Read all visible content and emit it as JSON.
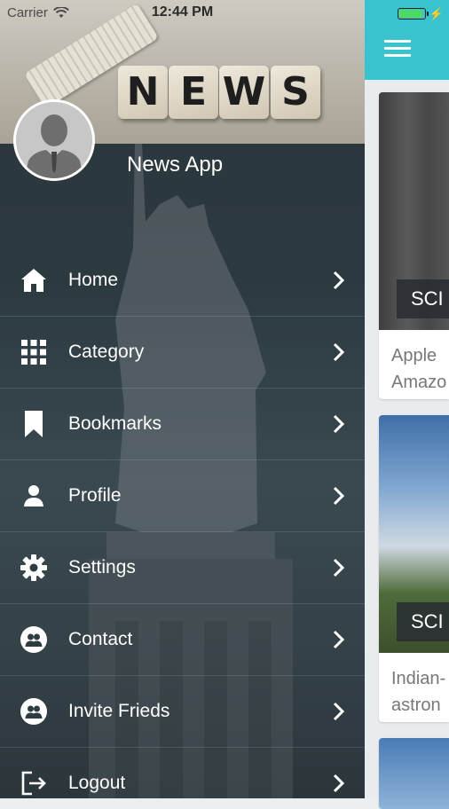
{
  "status_bar": {
    "carrier": "Carrier",
    "time": "12:44 PM",
    "battery_level": 1.0
  },
  "drawer": {
    "header_word": [
      "N",
      "E",
      "W",
      "S"
    ],
    "app_name": "News App",
    "menu": [
      {
        "label": "Home",
        "icon": "home-icon"
      },
      {
        "label": "Category",
        "icon": "grid-icon"
      },
      {
        "label": "Bookmarks",
        "icon": "bookmark-icon"
      },
      {
        "label": "Profile",
        "icon": "user-icon"
      },
      {
        "label": "Settings",
        "icon": "gear-icon"
      },
      {
        "label": "Contact",
        "icon": "contacts-icon"
      },
      {
        "label": "Invite Frieds",
        "icon": "invite-icon"
      },
      {
        "label": "Logout",
        "icon": "logout-icon"
      }
    ]
  },
  "feed": {
    "cards": [
      {
        "category": "SCI",
        "text_line1": "Apple",
        "text_line2": "Amazo"
      },
      {
        "category": "SCI",
        "text_line1": "Indian-",
        "text_line2": "astron"
      }
    ]
  },
  "colors": {
    "accent": "#39c3cf",
    "drawer_bg": "#2c3a40"
  }
}
